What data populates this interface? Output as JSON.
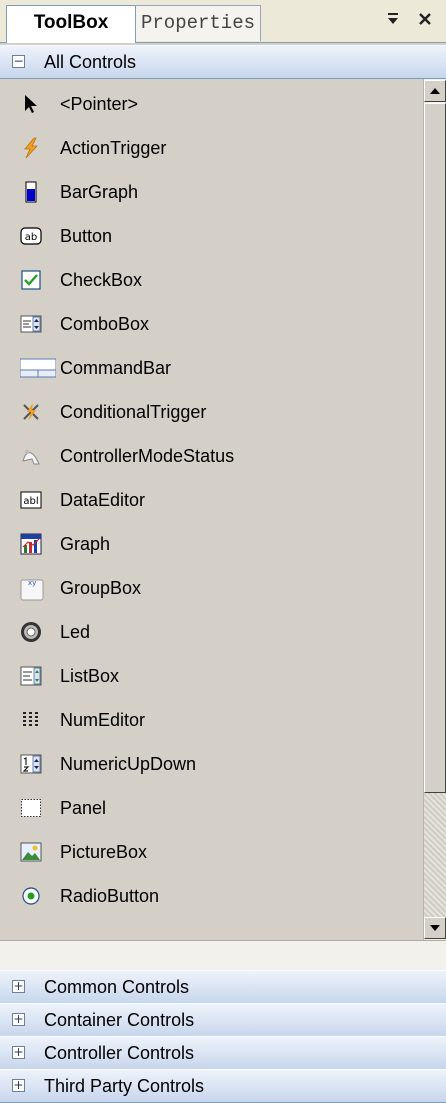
{
  "tabs": {
    "toolbox": "ToolBox",
    "properties": "Properties"
  },
  "header_buttons": {
    "pin": "₹",
    "close": "x"
  },
  "main_section": {
    "expander": "−",
    "label": "All Controls"
  },
  "items": [
    {
      "label": "<Pointer>",
      "icon": "pointer-icon"
    },
    {
      "label": "ActionTrigger",
      "icon": "lightning-icon"
    },
    {
      "label": "BarGraph",
      "icon": "bargraph-icon"
    },
    {
      "label": "Button",
      "icon": "button-icon"
    },
    {
      "label": "CheckBox",
      "icon": "checkbox-icon"
    },
    {
      "label": "ComboBox",
      "icon": "combobox-icon"
    },
    {
      "label": "CommandBar",
      "icon": "commandbar-icon"
    },
    {
      "label": "ConditionalTrigger",
      "icon": "conditional-trigger-icon"
    },
    {
      "label": "ControllerModeStatus",
      "icon": "controller-mode-icon"
    },
    {
      "label": "DataEditor",
      "icon": "dataeditor-icon"
    },
    {
      "label": "Graph",
      "icon": "graph-icon"
    },
    {
      "label": "GroupBox",
      "icon": "groupbox-icon"
    },
    {
      "label": "Led",
      "icon": "led-icon"
    },
    {
      "label": "ListBox",
      "icon": "listbox-icon"
    },
    {
      "label": "NumEditor",
      "icon": "numeditor-icon"
    },
    {
      "label": "NumericUpDown",
      "icon": "numericupdown-icon"
    },
    {
      "label": "Panel",
      "icon": "panel-icon"
    },
    {
      "label": "PictureBox",
      "icon": "picturebox-icon"
    },
    {
      "label": "RadioButton",
      "icon": "radiobutton-icon"
    }
  ],
  "icon_text": {
    "button": "ab",
    "dataeditor": "abl",
    "groupbox": "xy"
  },
  "collapsed_sections": [
    {
      "expander": "+",
      "label": "Common Controls"
    },
    {
      "expander": "+",
      "label": "Container Controls"
    },
    {
      "expander": "+",
      "label": "Controller Controls"
    },
    {
      "expander": "+",
      "label": "Third Party Controls"
    }
  ]
}
